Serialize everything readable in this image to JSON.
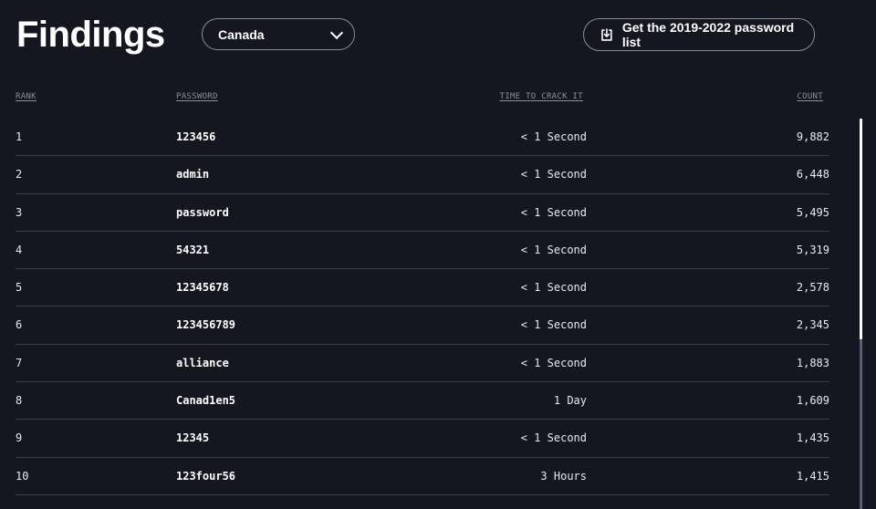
{
  "header": {
    "title": "Findings",
    "country_select": {
      "value": "Canada"
    },
    "download_button": {
      "label": "Get the 2019-2022 password list"
    }
  },
  "table": {
    "columns": {
      "rank": "RANK",
      "password": "PASSWORD",
      "time": "TIME TO CRACK IT",
      "count": "COUNT"
    },
    "rows": [
      {
        "rank": "1",
        "password": "123456",
        "time": "< 1 Second",
        "count": "9,882"
      },
      {
        "rank": "2",
        "password": "admin",
        "time": "< 1 Second",
        "count": "6,448"
      },
      {
        "rank": "3",
        "password": "password",
        "time": "< 1 Second",
        "count": "5,495"
      },
      {
        "rank": "4",
        "password": "54321",
        "time": "< 1 Second",
        "count": "5,319"
      },
      {
        "rank": "5",
        "password": "12345678",
        "time": "< 1 Second",
        "count": "2,578"
      },
      {
        "rank": "6",
        "password": "123456789",
        "time": "< 1 Second",
        "count": "2,345"
      },
      {
        "rank": "7",
        "password": "alliance",
        "time": "< 1 Second",
        "count": "1,883"
      },
      {
        "rank": "8",
        "password": "Canad1en5",
        "time": "1 Day",
        "count": "1,609"
      },
      {
        "rank": "9",
        "password": "12345",
        "time": "< 1 Second",
        "count": "1,435"
      },
      {
        "rank": "10",
        "password": "123four56",
        "time": "3 Hours",
        "count": "1,415"
      }
    ]
  },
  "icons": {
    "download": "download-icon",
    "dropdown": "chevron-down-icon"
  },
  "colors": {
    "background": "#141620",
    "text": "#ffffff",
    "muted": "#8d909c",
    "divider": "#3a3d4a",
    "scroll_track": "#5b5f7a"
  },
  "scroll": {
    "position_fraction": 0
  }
}
